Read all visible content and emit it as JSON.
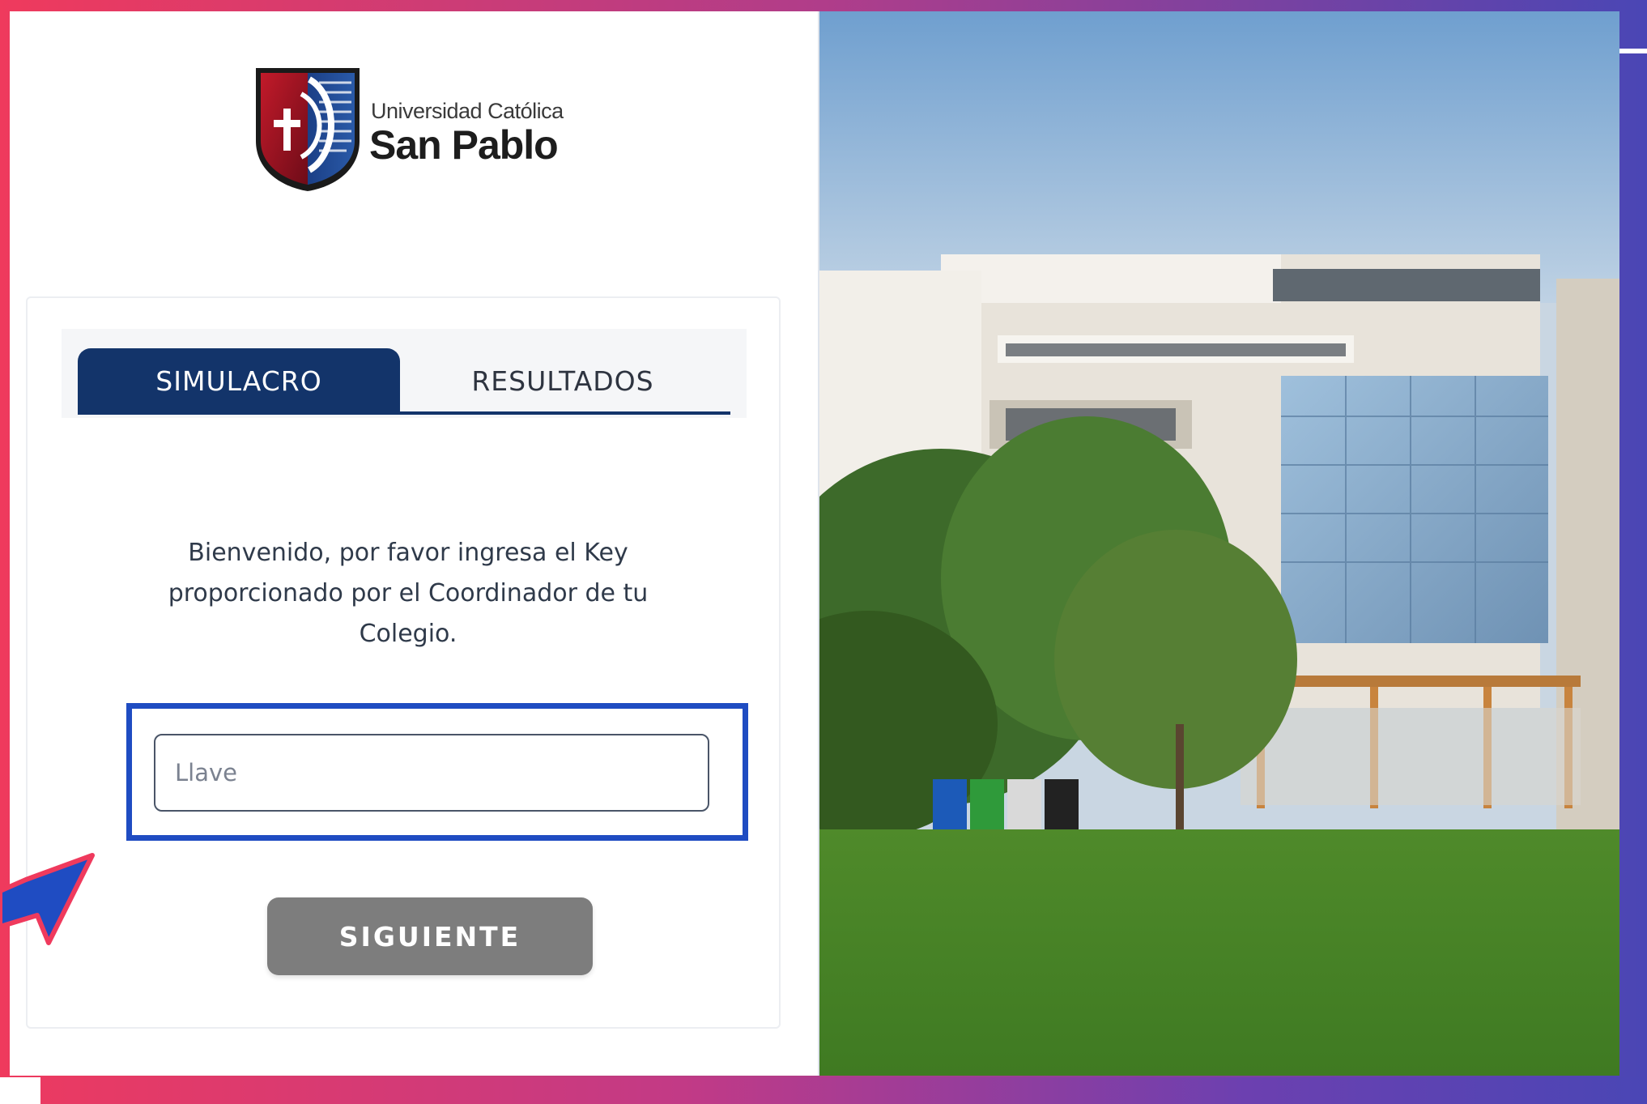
{
  "brand": {
    "name_small": "Universidad Católica",
    "name_big": "San Pablo"
  },
  "tabs": [
    {
      "label": "SIMULACRO",
      "active": true
    },
    {
      "label": "RESULTADOS",
      "active": false
    }
  ],
  "form": {
    "welcome_text": "Bienvenido, por favor ingresa el Key proporcionado por el Coordinador de tu Colegio.",
    "key_placeholder": "Llave",
    "key_value": "",
    "next_label": "SIGUIENTE"
  },
  "colors": {
    "primary": "#13346a",
    "highlight": "#1f4cc2",
    "button_disabled": "#7d7d7d",
    "frame_left": "#ef3a5d",
    "frame_right": "#4a46b5"
  },
  "icons": {
    "logo": "university-shield-logo",
    "pointer": "pointer-arrow-icon"
  }
}
